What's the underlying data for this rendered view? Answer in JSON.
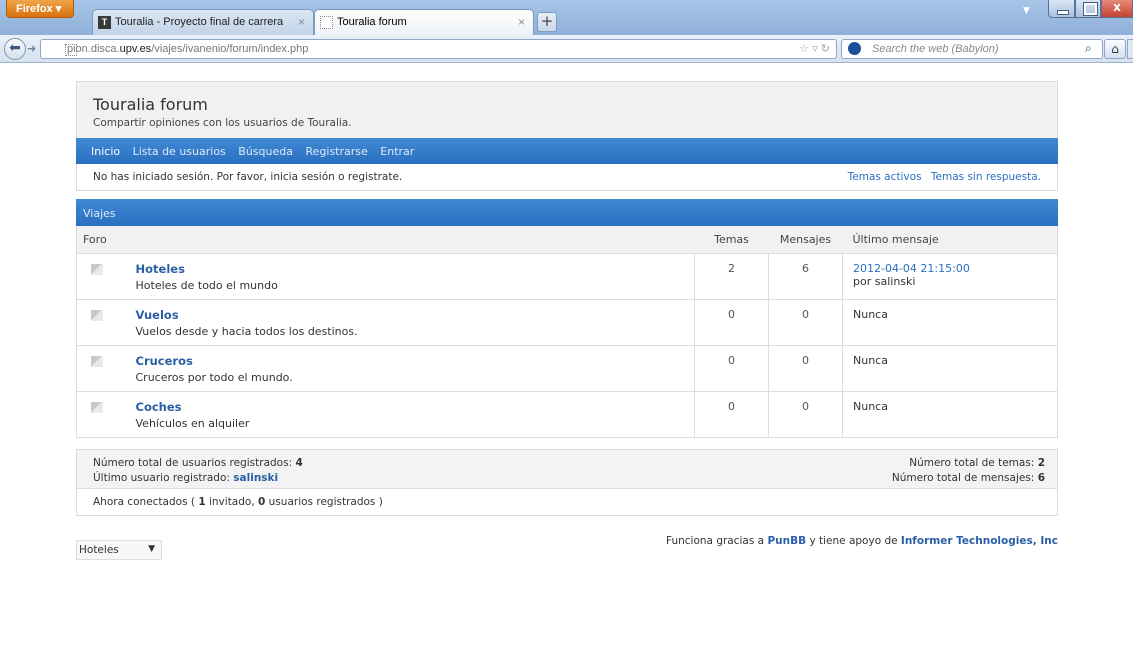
{
  "browser": {
    "app_button": "Firefox",
    "tabs": [
      {
        "label": "Touralia - Proyecto final de carrera",
        "close": "×"
      },
      {
        "label": "Touralia forum",
        "close": "×"
      }
    ],
    "new_tab": "+",
    "url_host_pre": "pion.disca.",
    "url_host_bold": "upv.es",
    "url_path": "/viajes/ivanenio/forum/index.php",
    "search_placeholder": "Search the web (Babylon)"
  },
  "forum": {
    "title": "Touralia forum",
    "description": "Compartir opiniones con los usuarios de Touralia.",
    "menu": [
      "Inicio",
      "Lista de usuarios",
      "Búsqueda",
      "Registrarse",
      "Entrar"
    ],
    "welcome": "No has iniciado sesión. Por favor, inicia sesión o registrate.",
    "quick_links": [
      "Temas activos",
      "Temas sin respuesta."
    ],
    "category": "Viajes",
    "columns": {
      "forum": "Foro",
      "topics": "Temas",
      "posts": "Mensajes",
      "last": "Último mensaje"
    },
    "forums": [
      {
        "name": "Hoteles",
        "desc": "Hoteles de todo el mundo",
        "topics": "2",
        "posts": "6",
        "last_date": "2012-04-04 21:15:00",
        "last_by": "por salinski"
      },
      {
        "name": "Vuelos",
        "desc": "Vuelos desde y hacia todos los destinos.",
        "topics": "0",
        "posts": "0",
        "last_date": "Nunca",
        "last_by": ""
      },
      {
        "name": "Cruceros",
        "desc": "Cruceros por todo el mundo.",
        "topics": "0",
        "posts": "0",
        "last_date": "Nunca",
        "last_by": ""
      },
      {
        "name": "Coches",
        "desc": "Vehículos en alquiler",
        "topics": "0",
        "posts": "0",
        "last_date": "Nunca",
        "last_by": ""
      }
    ],
    "stats": {
      "users_label": "Número total de usuarios registrados:",
      "users_value": "4",
      "newest_label": "Último usuario registrado:",
      "newest_value": "salinski",
      "topics_label": "Número total de temas:",
      "topics_value": "2",
      "posts_label": "Número total de mensajes:",
      "posts_value": "6"
    },
    "online": {
      "prefix": "Ahora conectados (",
      "guests": "1",
      "guests_label": "invitado,",
      "registered": "0",
      "registered_label": "usuarios registrados )"
    },
    "jump_selected": "Hoteles",
    "footer": {
      "text1": "Funciona gracias a",
      "punbb": "PunBB",
      "text2": "y tiene apoyo de",
      "informer": "Informer Technologies, Inc"
    }
  }
}
